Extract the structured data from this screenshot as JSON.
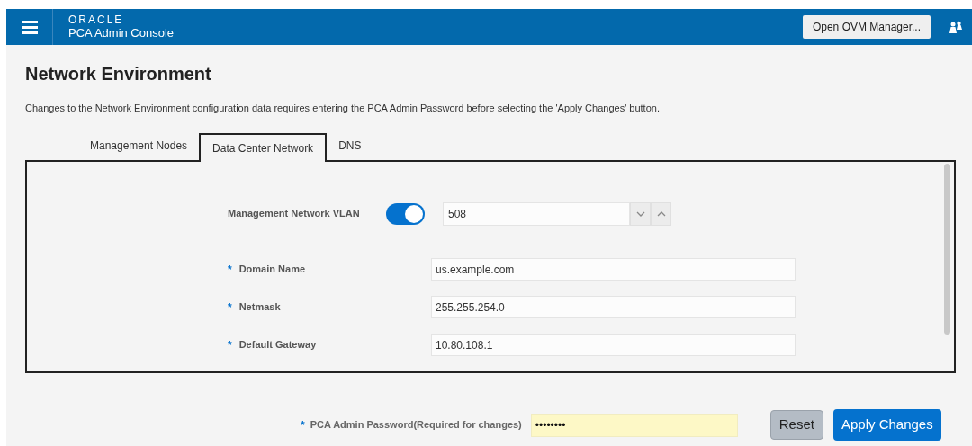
{
  "header": {
    "brand": "ORACLE",
    "app_title": "PCA Admin Console",
    "ovm_button": "Open OVM Manager..."
  },
  "page": {
    "title": "Network Environment",
    "description": "Changes to the Network Environment configuration data requires entering the PCA Admin Password before selecting the 'Apply Changes' button."
  },
  "tabs": [
    {
      "label": "Management Nodes",
      "selected": false
    },
    {
      "label": "Data Center Network",
      "selected": true
    },
    {
      "label": "DNS",
      "selected": false
    }
  ],
  "fields": [
    {
      "kind": "toggle-number",
      "label": "Management Network VLAN",
      "required": false,
      "on": true,
      "value": "508"
    },
    {
      "kind": "text",
      "label": "Domain Name",
      "required": true,
      "value": "us.example.com"
    },
    {
      "kind": "text",
      "label": "Netmask",
      "required": true,
      "value": "255.255.254.0"
    },
    {
      "kind": "text",
      "label": "Default Gateway",
      "required": true,
      "value": "10.80.108.1"
    }
  ],
  "password": {
    "required_mark": "*",
    "label": "PCA Admin Password(Required for changes)",
    "value": "••••••••"
  },
  "buttons": {
    "reset": "Reset",
    "apply": "Apply Changes"
  }
}
